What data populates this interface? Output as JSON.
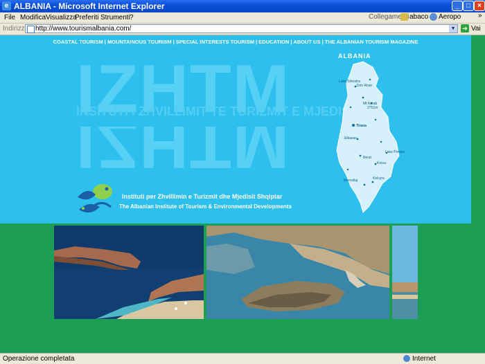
{
  "window": {
    "title": "ALBANIA - Microsoft Internet Explorer",
    "icon": "ie-icon"
  },
  "menu": {
    "items": [
      "File",
      "Modifica",
      "Visualizza",
      "Preferiti",
      "Strumenti",
      "?"
    ],
    "links_label": "Collegamenti",
    "links": [
      "abaco",
      "Aeropo"
    ],
    "overflow": "»"
  },
  "address": {
    "label": "Indirizzo",
    "url": "http://www.tourismalbania.com/",
    "go_label": "Vai"
  },
  "site": {
    "nav": [
      "COASTAL TOURISM",
      "MOUNTAINOUS TOURISM",
      "SPECIAL INTERESTS TOURISM",
      "EDUCATION",
      "ABOUT US",
      "THE ALBANIAN TOURISM MAGAZINE"
    ],
    "nav_separator": " | ",
    "big_letters": "IZHTM",
    "big_line": "INSITUTI I ZHVILLIMIT TE TURIZMIT E MJEDISIT",
    "institute_al": "Instituti per Zhvillimin e Turizmit dhe Mjedisit Shqiptar",
    "institute_en": "The Albanian Institute of Tourism & Environmental Developments",
    "map_title": "ALBANIA",
    "map_labels": [
      "Lake Shkodra",
      "Drin River",
      "Mt Korab",
      "2751m",
      "Tirana",
      "Elbasan",
      "Berat",
      "Korca",
      "Lake Prespa",
      "Memaliaj",
      "Kelcyra"
    ]
  },
  "status": {
    "text": "Operazione completata",
    "zone": "Internet"
  },
  "colors": {
    "banner": "#2dc0ef",
    "page_bg": "#1d9e55",
    "title_bar": "#0a4fd8"
  }
}
